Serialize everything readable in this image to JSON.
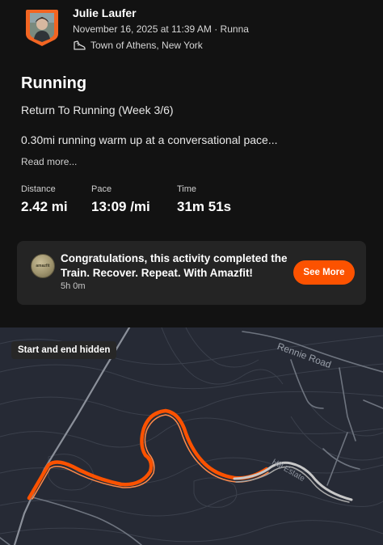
{
  "header": {
    "user_name": "Julie Laufer",
    "meta": "November 16, 2025 at 11:39 AM · Runna",
    "location": "Town of Athens, New York"
  },
  "activity": {
    "title": "Running",
    "subtitle": "Return To Running (Week 3/6)",
    "description": "0.30mi running warm up at a conversational pace...",
    "read_more": "Read more..."
  },
  "stats": [
    {
      "label": "Distance",
      "value": "2.42 mi"
    },
    {
      "label": "Pace",
      "value": "13:09 /mi"
    },
    {
      "label": "Time",
      "value": "31m 51s"
    }
  ],
  "promo": {
    "text": "Congratulations, this activity completed the Train. Recover. Repeat. With Amazfit!",
    "duration": "5h 0m",
    "button": "See More",
    "logo_text": "amazfit"
  },
  "map": {
    "pill": "Start and end hidden",
    "road_label": "Rennie Road",
    "road_label_2": "Hill Estate"
  },
  "colors": {
    "background": "#121212",
    "card": "#242424",
    "accent": "#fc5200",
    "map_bg": "#262a35"
  },
  "icons": [
    "avatar-badge",
    "shoe-icon",
    "amazfit-logo"
  ]
}
